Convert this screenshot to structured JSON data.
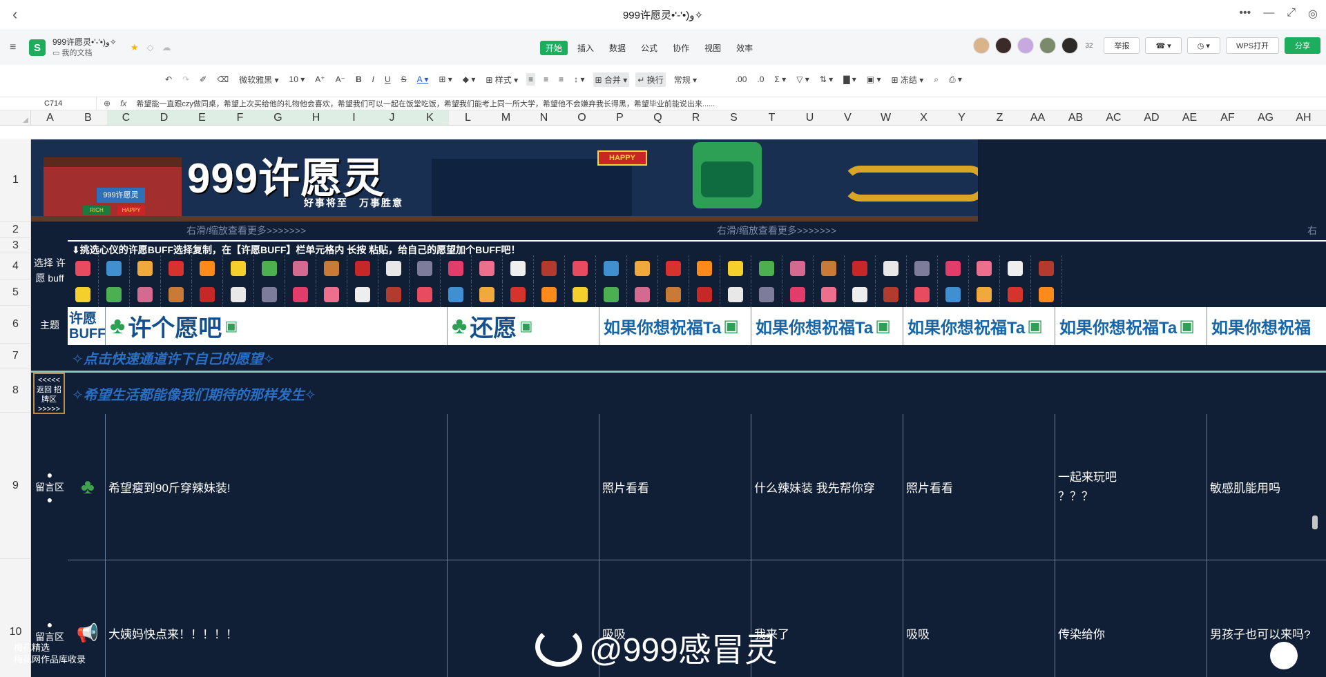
{
  "window": {
    "title": "999许愿灵•'-'•)و✧"
  },
  "header": {
    "doc_name": "999许愿灵•'-'•)و✧",
    "folder": "我的文档",
    "app_logo": "S",
    "tabs": [
      {
        "label": "开始",
        "active": true
      },
      {
        "label": "插入"
      },
      {
        "label": "数据"
      },
      {
        "label": "公式"
      },
      {
        "label": "协作"
      },
      {
        "label": "视图"
      },
      {
        "label": "效率"
      }
    ],
    "collaborator_count": "32",
    "report_label": "举报",
    "wps_open_label": "WPS打开",
    "share_label": "分享"
  },
  "toolbar": {
    "font": "微软雅黑",
    "font_size": "10",
    "style_label": "样式",
    "merge_label": "合并",
    "wrap_label": "换行",
    "number_format": "常规",
    "freeze_label": "冻结"
  },
  "formula_bar": {
    "cell_ref": "C714",
    "content": "希望能一直跟czy做同桌，希望上次买给他的礼物他会喜欢，希望我们可以一起在饭堂吃饭，希望我们能考上同一所大学，希望他不会嫌弃我长得黑，希望毕业前能说出来......"
  },
  "columns": [
    "A",
    "B",
    "C",
    "D",
    "E",
    "F",
    "G",
    "H",
    "I",
    "J",
    "K",
    "L",
    "M",
    "N",
    "O",
    "P",
    "Q",
    "R",
    "S",
    "T",
    "U",
    "V",
    "W",
    "X",
    "Y",
    "Z",
    "AA",
    "AB",
    "AC",
    "AD",
    "AE",
    "AF",
    "AG",
    "AH"
  ],
  "rows": [
    "1",
    "2",
    "3",
    "4",
    "5",
    "6",
    "7",
    "8",
    "9",
    "10"
  ],
  "banner": {
    "title": "999许愿灵",
    "subtitle": "好事将至　万事胜意",
    "happy": "HAPPY",
    "booth_sign": "999许愿灵",
    "rich": "RICH",
    "happy2": "HAPPY"
  },
  "sheet": {
    "scroll_hint": "右滑/缩放查看更多>>>>>>>",
    "scroll_hint_cut": "右",
    "instruction": "⬇挑选心仪的许愿BUFF选择复制，在【许愿BUFF】栏单元格内 长按 粘贴，给自己的愿望加个BUFF吧！",
    "select_label": "选择 许愿 buff",
    "theme_label": "主题",
    "theme_buff": "许愿 BUFF",
    "theme_wish": "许个愿吧",
    "theme_return": "还愿",
    "theme_bless": "如果你想祝福Ta",
    "theme_bless_cut": "如果你想祝福",
    "quick_link": "✧点击快速通道许下自己的愿望✧",
    "hope_line": "✧希望生活都能像我们期待的那样发生✧",
    "back_nav": "<<<<< 返回 招牌区 >>>>>",
    "message_label": "留言区"
  },
  "messages": [
    {
      "wish": "希望瘦到90斤穿辣妹装!",
      "replies": [
        "",
        "照片看看",
        "什么辣妹装 我先帮你穿",
        "照片看看",
        "一起来玩吧",
        "敏感肌能用吗"
      ],
      "extra": "？？？"
    },
    {
      "wish": "大姨妈快点来！！！！！",
      "replies": [
        "",
        "吸吸",
        "我来了",
        "吸吸",
        "传染给你",
        "男孩子也可以来吗?"
      ]
    }
  ],
  "watermark": {
    "handle": "@999感冒灵",
    "source_line1": "梅花精选",
    "source_line2": "梅花网作品库收录"
  },
  "colors": {
    "sheet_bg": "#101f36",
    "accent": "#1cae5c",
    "theme_text": "#1565a8"
  }
}
